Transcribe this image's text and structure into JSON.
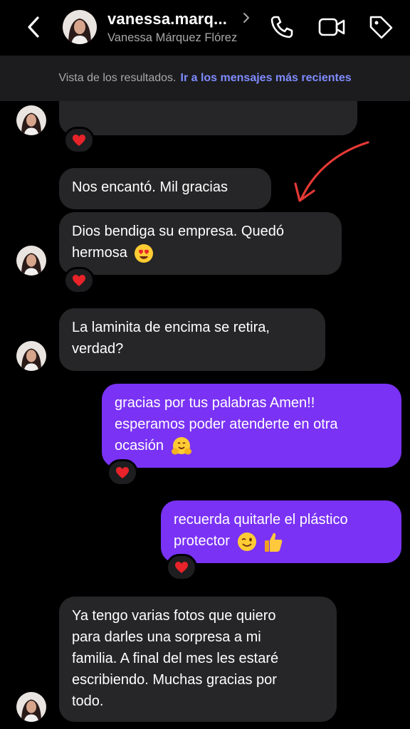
{
  "header": {
    "username": "vanessa.marq...",
    "full_name": "Vanessa Márquez Flórez",
    "icons": [
      "back-icon",
      "phone-icon",
      "video-icon",
      "tag-icon"
    ]
  },
  "banner": {
    "text": "Vista de los resultados.",
    "link": "Ir a los mensajes más recientes"
  },
  "messages": [
    {
      "from": "them",
      "lines": [
        ""
      ],
      "reaction": "heart"
    },
    {
      "from": "them",
      "lines": [
        "Nos encantó. Mil gracias"
      ]
    },
    {
      "from": "them",
      "lines": [
        "Dios bendiga su empresa. Quedó",
        "hermosa"
      ],
      "emoji": "heart-eyes",
      "reaction": "heart"
    },
    {
      "from": "them",
      "lines": [
        "La laminita de encima se retira,",
        "verdad?"
      ]
    },
    {
      "from": "me",
      "lines": [
        "gracias por tus palabras Amen!!",
        "esperamos poder atenderte en otra",
        "ocasión"
      ],
      "emoji": "hugging",
      "reaction": "heart"
    },
    {
      "from": "me",
      "lines": [
        "recuerda quitarle el plástico",
        "protector"
      ],
      "emoji": [
        "wink",
        "thumbs-up"
      ],
      "reaction": "heart"
    },
    {
      "from": "them",
      "lines": [
        "Ya tengo varias fotos que quiero",
        "para darles una sorpresa a mi",
        "familia. A final del mes les estaré",
        "escribiendo. Muchas gracias por",
        "todo."
      ]
    }
  ],
  "colors": {
    "background": "#000000",
    "incoming_bubble": "#262628",
    "outgoing_bubble": "#7a32f5",
    "link": "#7f8bff",
    "annotation_arrow": "#e53935"
  }
}
